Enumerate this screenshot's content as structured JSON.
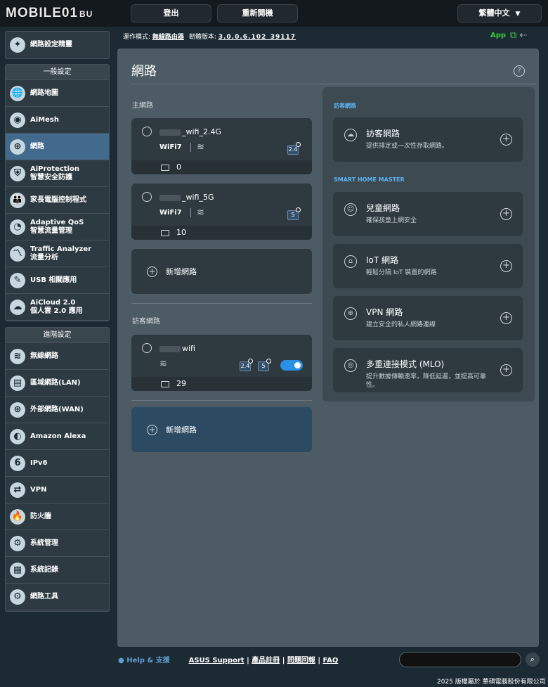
{
  "brand": {
    "logo": "MOBILE01",
    "logo_suffix": "BU"
  },
  "top": {
    "logout": "登出",
    "reboot": "重新開機",
    "language": "繁體中文"
  },
  "status": {
    "mode_label": "運作模式:",
    "mode_value": "無線路由器",
    "firmware_label": "韌體版本:",
    "firmware_value": "3.0.0.6.102_39117",
    "app": "App"
  },
  "sidebar": {
    "setup": "網路設定精靈",
    "general_header": "一般設定",
    "general": [
      "網路地圖",
      "AiMesh",
      "網路",
      "AiProtection\n智慧安全防護",
      "家長電腦控制程式",
      "Adaptive QoS\n智慧流量管理",
      "Traffic Analyzer\n流量分析",
      "USB 相關應用",
      "AiCloud 2.0\n個人雲 2.0 應用"
    ],
    "advanced_header": "進階設定",
    "advanced": [
      "無線網路",
      "區域網路(LAN)",
      "外部網路(WAN)",
      "Amazon Alexa",
      "IPv6",
      "VPN",
      "防火牆",
      "系統管理",
      "系統記錄",
      "網路工具"
    ]
  },
  "main": {
    "title": "網路",
    "primary_section": "主網路",
    "networks": [
      {
        "ssid": "_wifi_2.4G",
        "wifi": "WiFi7",
        "band": "2.4",
        "clients": "0"
      },
      {
        "ssid": "_wifi_5G",
        "wifi": "WiFi7",
        "band": "5",
        "clients": "10"
      }
    ],
    "add_network": "新增網路",
    "guest_section": "訪客網路",
    "guest": {
      "ssid": "wifi",
      "band1": "2.4",
      "band2": "5",
      "clients": "29",
      "enabled": true
    },
    "add_network2": "新增網路"
  },
  "right": {
    "guest_section": "訪客網路",
    "guest_card": {
      "title": "訪客網路",
      "desc": "提供排定或一次性存取網路。"
    },
    "smart_section": "SMART HOME MASTER",
    "cards": [
      {
        "title": "兒童網路",
        "desc": "確保孩童上網安全"
      },
      {
        "title": "IoT 網路",
        "desc": "輕鬆分隔 IoT 裝置的網路"
      },
      {
        "title": "VPN 網路",
        "desc": "建立安全的私人網路連線"
      },
      {
        "title": "多重連接模式 (MLO)",
        "desc": "提升數據傳輸速率，降低延遲，並提高可靠性。"
      }
    ]
  },
  "footer": {
    "help": "Help & 支援",
    "asus": "ASUS Support",
    "reg": "產品註冊",
    "feedback": "問題回報",
    "faq": "FAQ",
    "sep": "|",
    "copyright": "2025 版權屬於 華碩電腦股份有限公司"
  }
}
